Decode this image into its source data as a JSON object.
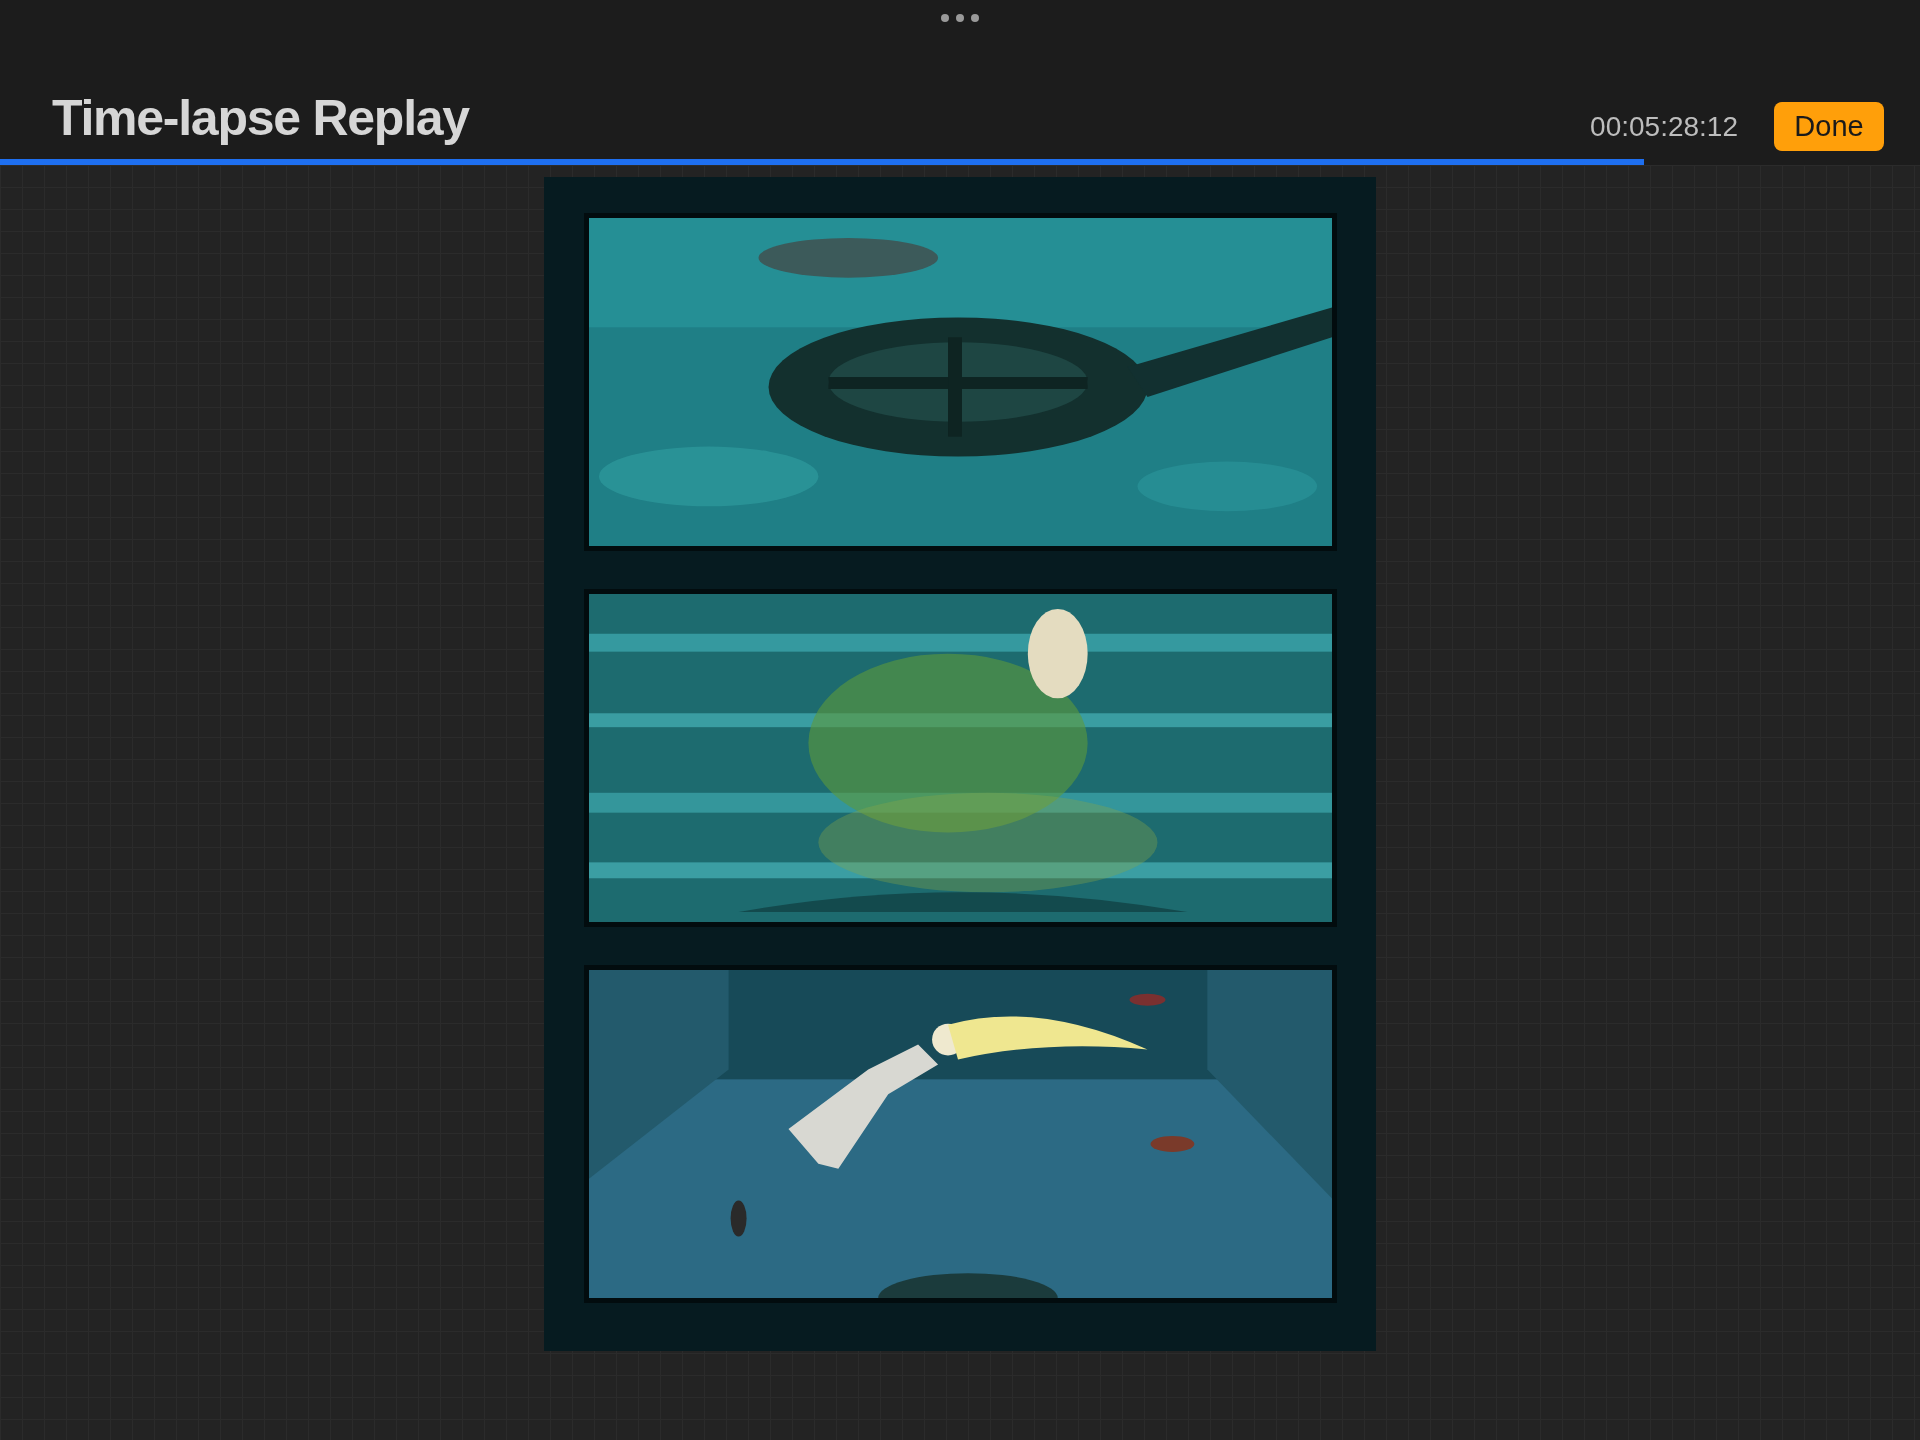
{
  "header": {
    "title": "Time-lapse Replay",
    "timestamp": "00:05:28:12",
    "done_button": "Done"
  },
  "progress": {
    "level": 0.856
  }
}
